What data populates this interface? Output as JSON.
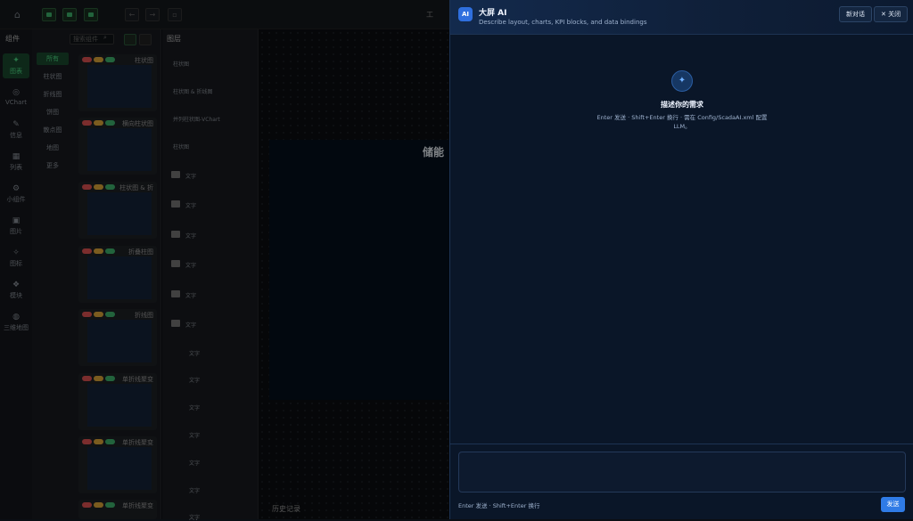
{
  "topbar": {
    "title_partial": "工"
  },
  "leftnav": {
    "header": "组件",
    "items": [
      {
        "label": "图表",
        "icon": "bar-chart-icon"
      },
      {
        "label": "VChart",
        "icon": "vchart-icon"
      },
      {
        "label": "信息",
        "icon": "info-icon"
      },
      {
        "label": "列表",
        "icon": "list-icon"
      },
      {
        "label": "小组件",
        "icon": "widget-icon"
      },
      {
        "label": "图片",
        "icon": "image-icon"
      },
      {
        "label": "图标",
        "icon": "icon-icon"
      },
      {
        "label": "模块",
        "icon": "module-icon"
      },
      {
        "label": "三维地图",
        "icon": "globe-icon"
      }
    ]
  },
  "components": {
    "search_placeholder": "搜索组件",
    "categories": [
      "所有",
      "柱状图",
      "折线图",
      "饼图",
      "散点图",
      "地图",
      "更多"
    ],
    "thumbnails": [
      "柱状图",
      "横向柱状图",
      "柱状图 & 折",
      "折叠柱图",
      "折线图",
      "单折线聚变",
      "单折线聚变",
      "单折线聚变"
    ]
  },
  "layers": {
    "header": "图层",
    "items": [
      "柱状图",
      "柱状图 & 折线图",
      "并列柱状图-VChart",
      "柱状图",
      "文字",
      "文字",
      "文字",
      "文字",
      "文字",
      "文字",
      "文字",
      "文字",
      "文字",
      "文字",
      "文字",
      "文字",
      "文字"
    ]
  },
  "canvas": {
    "screen_title": "储能",
    "history": "历史记录"
  },
  "ai_panel": {
    "logo": "AI",
    "title": "大屏 AI",
    "subtitle": "Describe layout, charts, KPI blocks, and data bindings",
    "new_chat": "新对话",
    "close": "✕ 关闭",
    "prompt_title": "描述你的需求",
    "hint": "Enter 发送 · Shift+Enter 换行 · 需在 Config/ScadaAI.xml 配置 LLM。",
    "input_placeholder": "",
    "footer_hint": "Enter 发送 · Shift+Enter 换行",
    "send": "发送"
  },
  "colors": {
    "accent": "#2f7be6",
    "green": "#4cd984",
    "panel_bg": "#0a1628"
  }
}
